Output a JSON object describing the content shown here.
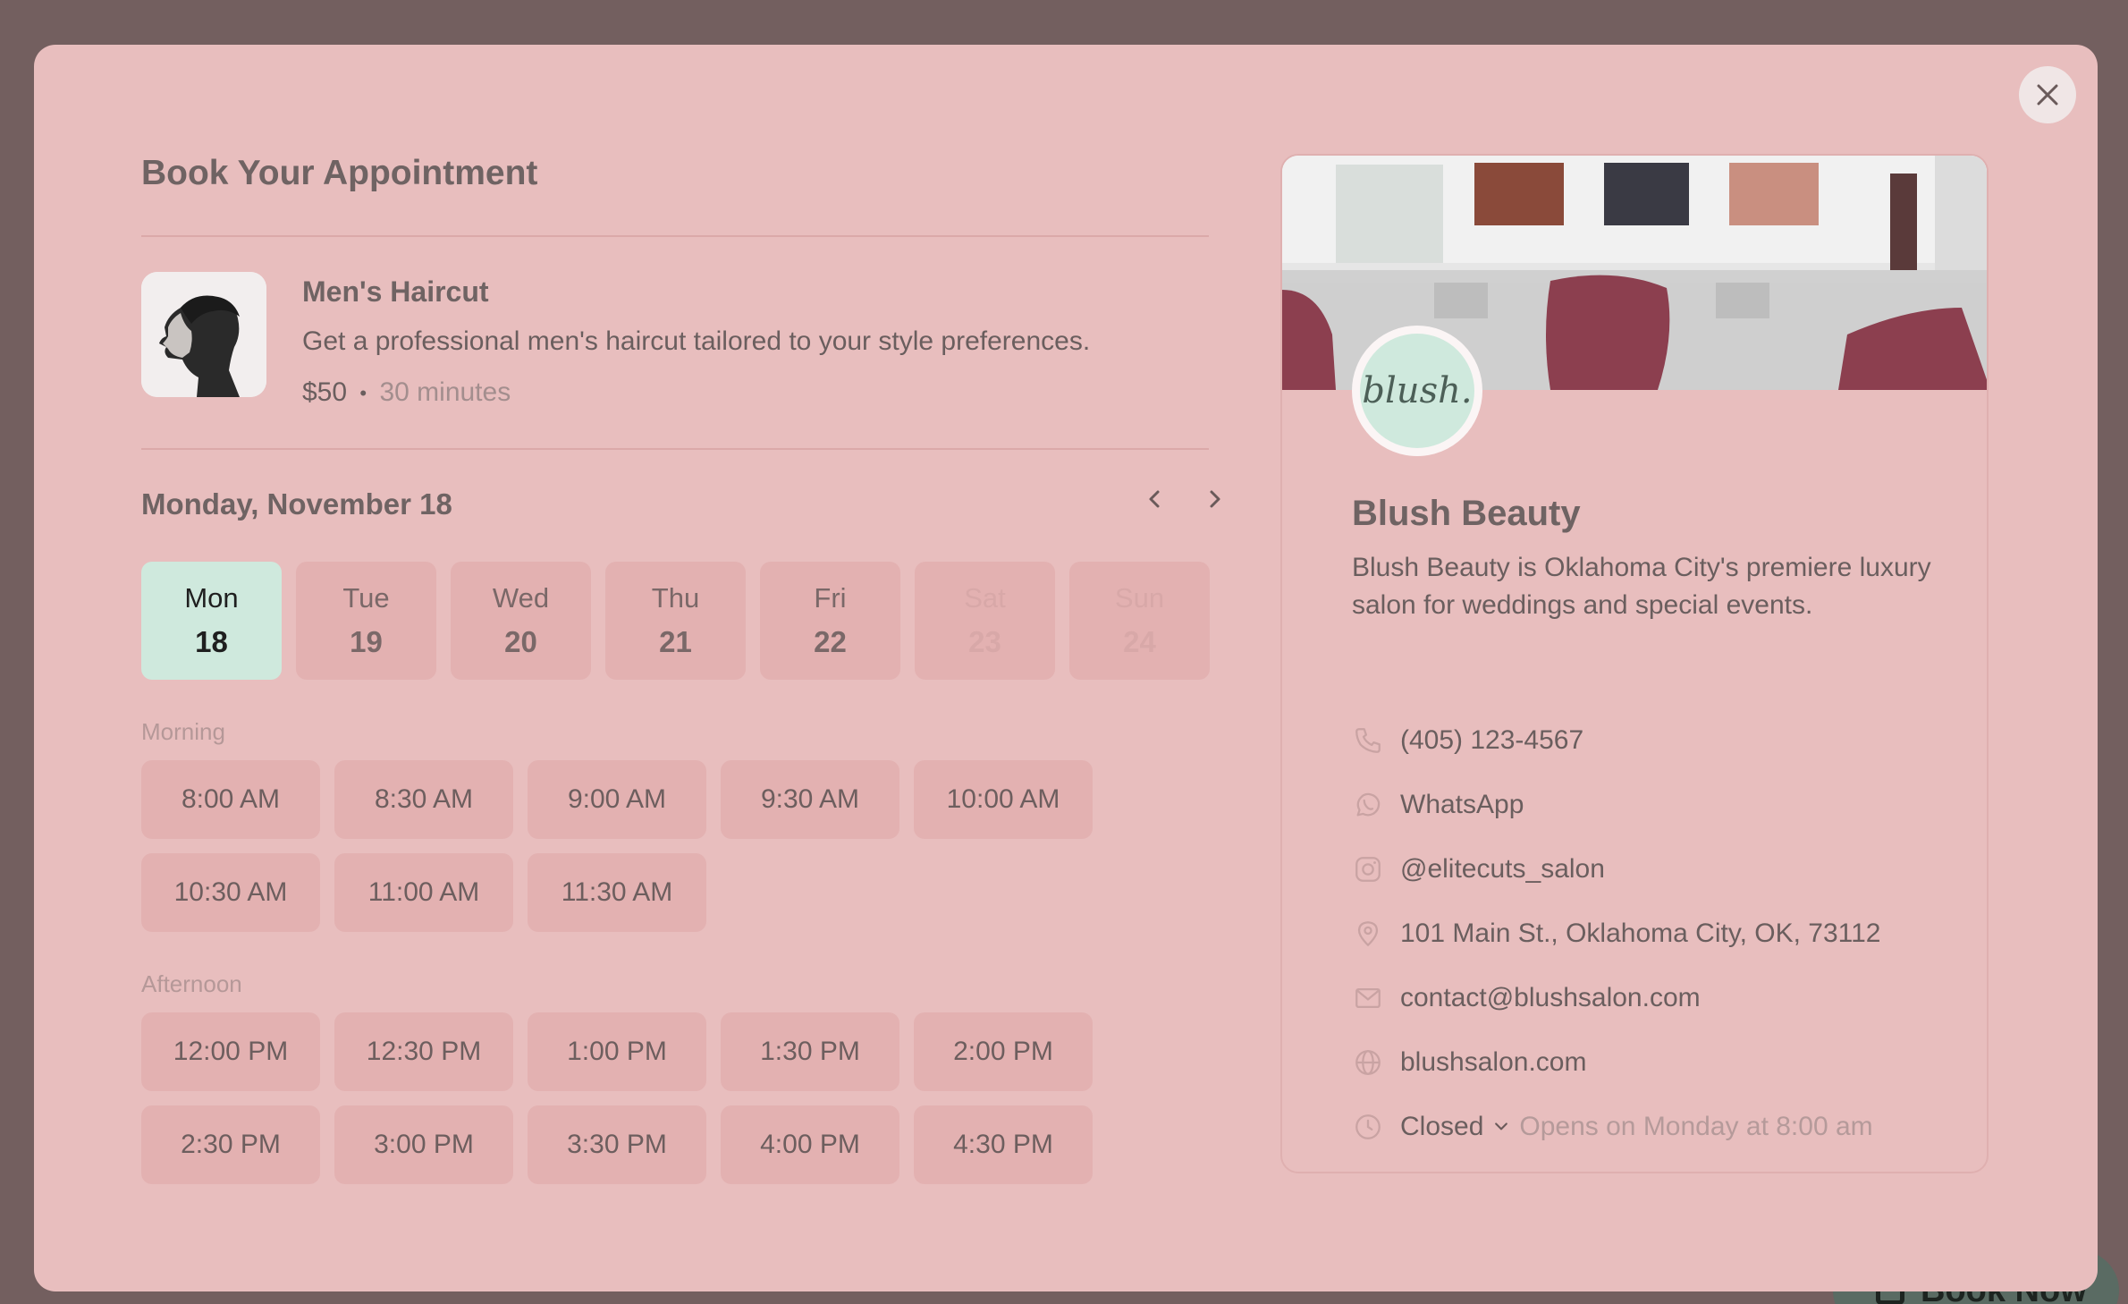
{
  "booking": {
    "title": "Book Your Appointment",
    "service": {
      "name": "Men's Haircut",
      "description": "Get a professional men's haircut tailored to your style preferences.",
      "price": "$50",
      "separator": "•",
      "duration": "30 minutes"
    },
    "date_heading": "Monday, November 18",
    "days": [
      {
        "name": "Mon",
        "num": "18",
        "state": "selected"
      },
      {
        "name": "Tue",
        "num": "19",
        "state": "available"
      },
      {
        "name": "Wed",
        "num": "20",
        "state": "available"
      },
      {
        "name": "Thu",
        "num": "21",
        "state": "available"
      },
      {
        "name": "Fri",
        "num": "22",
        "state": "available"
      },
      {
        "name": "Sat",
        "num": "23",
        "state": "disabled"
      },
      {
        "name": "Sun",
        "num": "24",
        "state": "disabled"
      }
    ],
    "morning_label": "Morning",
    "morning_slots": [
      "8:00 AM",
      "8:30 AM",
      "9:00 AM",
      "9:30 AM",
      "10:00 AM",
      "10:30 AM",
      "11:00 AM",
      "11:30 AM"
    ],
    "afternoon_label": "Afternoon",
    "afternoon_slots": [
      "12:00 PM",
      "12:30 PM",
      "1:00 PM",
      "1:30 PM",
      "2:00 PM",
      "2:30 PM",
      "3:00 PM",
      "3:30 PM",
      "4:00 PM",
      "4:30 PM"
    ]
  },
  "business": {
    "logo_text": "blush.",
    "name": "Blush Beauty",
    "description": "Blush Beauty is Oklahoma City's premiere luxury salon for weddings and special events.",
    "phone": "(405) 123-4567",
    "whatsapp": "WhatsApp",
    "instagram": "@elitecuts_salon",
    "address": "101 Main St., Oklahoma City, OK, 73112",
    "email": "contact@blushsalon.com",
    "website": "blushsalon.com",
    "status": "Closed",
    "opens": "Opens on Monday at 8:00 am"
  },
  "fab": {
    "label": "Book Now"
  },
  "colors": {
    "backdrop": "#735f5f",
    "modal": "#e8bebe",
    "selected_day": "#cfe9dd",
    "slot": "#e3b1b1"
  }
}
